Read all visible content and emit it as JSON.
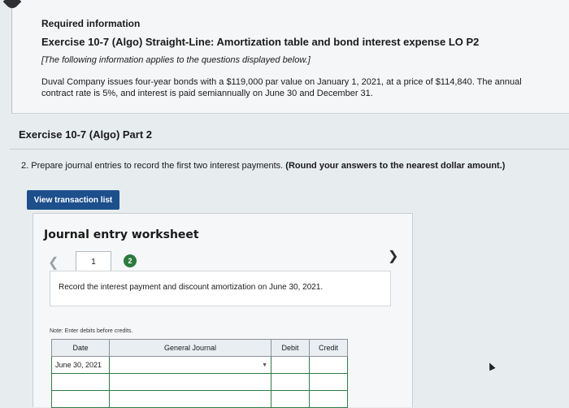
{
  "info": {
    "heading": "Required information",
    "exercise_title": "Exercise 10-7 (Algo) Straight-Line: Amortization table and bond interest expense LO P2",
    "note": "[The following information applies to the questions displayed below.]",
    "description": "Duval Company issues four-year bonds with a $119,000 par value on January 1, 2021, at a price of $114,840. The annual contract rate is 5%, and interest is paid semiannually on June 30 and December 31."
  },
  "part_title": "Exercise 10-7 (Algo) Part 2",
  "question": {
    "text": "2. Prepare journal entries to record the first two interest payments.",
    "emphasis": "(Round your answers to the nearest dollar amount.)"
  },
  "view_transaction_button": "View transaction list",
  "worksheet": {
    "title": "Journal entry worksheet",
    "pages": [
      "1",
      "2"
    ],
    "current_page": "1",
    "record_instruction": "Record the interest payment and discount amortization on June 30, 2021.",
    "note": "Note: Enter debits before credits.",
    "table": {
      "headers": [
        "Date",
        "General Journal",
        "Debit",
        "Credit"
      ],
      "rows": [
        {
          "date": "June 30, 2021",
          "account": "",
          "debit": "",
          "credit": ""
        },
        {
          "date": "",
          "account": "",
          "debit": "",
          "credit": ""
        },
        {
          "date": "",
          "account": "",
          "debit": "",
          "credit": ""
        }
      ]
    }
  },
  "icons": {
    "prev": "chevron-left-icon",
    "next": "chevron-right-icon",
    "dropdown": "dropdown-icon"
  },
  "colors": {
    "button_bg": "#1c4f8c",
    "active_page": "#2a7a3e",
    "table_border": "#2f7c46"
  }
}
